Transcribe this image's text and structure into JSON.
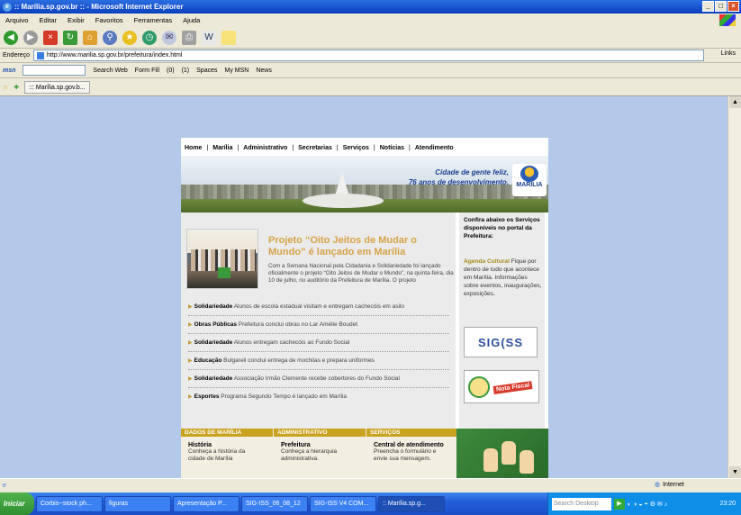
{
  "window": {
    "title": ":: Marília.sp.gov.br :: - Microsoft Internet Explorer"
  },
  "menu": [
    "Arquivo",
    "Editar",
    "Exibir",
    "Favoritos",
    "Ferramentas",
    "Ajuda"
  ],
  "address": {
    "label": "Endereço",
    "url": "http://www.marilia.sp.gov.br/prefeitura/index.html",
    "links": "Links"
  },
  "msnbar": {
    "logo": "msn",
    "search": "Search Web",
    "formfill": "Form Fill",
    "mail": "(0)",
    "contacts": "(1)",
    "spaces": "Spaces",
    "mymsn": "My MSN",
    "news": "News"
  },
  "tab": {
    "label": "::: Marília.sp.gov.b..."
  },
  "site": {
    "nav": [
      "Home",
      "Marília",
      "Administrativo",
      "Secretarias",
      "Serviços",
      "Notícias",
      "Atendimento"
    ],
    "slogan1": "Cidade de gente feliz,",
    "slogan2": "76 anos de desenvolvimento.",
    "logo": "MARÍLIA",
    "feature": {
      "title": "Projeto “Oito Jeitos de Mudar o Mundo” é lançado em Marília",
      "text": "Com a Semana Nacional pela Cidadania e Solidariedade foi lançado oficialmente o projeto “Oito Jeitos de Mudar o Mundo”, na quinta-feira, dia 10 de julho, no auditório da Prefeitura de Marília. O projeto"
    },
    "news": [
      {
        "cat": "Solidariedade",
        "text": "Alunos de escola estadual visitam e entregam cachecóis em asilo"
      },
      {
        "cat": "Obras Públicas",
        "text": "Prefeitura conclui obras no Lar Amélie Boudet"
      },
      {
        "cat": "Solidariedade",
        "text": "Alunos entregam cachecóis ao Fundo Social"
      },
      {
        "cat": "Educação",
        "text": "Bulgareli conclui entrega de mochilas e prepara uniformes"
      },
      {
        "cat": "Solidariedade",
        "text": "Associação Irmão Clemente recebe cobertores do Fundo Social"
      },
      {
        "cat": "Esportes",
        "text": "Programa Segundo Tempo é lançado em Marília"
      }
    ],
    "side": {
      "intro": "Confira abaixo os Serviços disponíveis no portal da Prefeitura:",
      "agenda_title": "Agenda Cultural",
      "agenda_text": "Fique por dentro de tudo que acontece em Marília. Informações sobre eventos, inaugurações, exposições.",
      "sigiss": "SIG(SS",
      "nota": "Nota Fiscal"
    },
    "footer": [
      {
        "hdr": "DADOS DE MARÍLIA",
        "h": "História",
        "t1": "Conheça a história da",
        "t2": "cidade de Marília"
      },
      {
        "hdr": "ADMINISTRATIVO",
        "h": "Prefeitura",
        "t1": "Conheça a hierarquia",
        "t2": "administrativa."
      },
      {
        "hdr": "SERVIÇOS",
        "h": "Central de atendimento",
        "t1": "Preencha o formulário e",
        "t2": "envie sua mensagem."
      }
    ]
  },
  "status": {
    "zone": "Internet"
  },
  "taskbar": {
    "start": "Iniciar",
    "tasks": [
      "Corbis--stock ph...",
      "figuras",
      "Apresentação P...",
      "SIG-ISS_06_08_12",
      "SIG-ISS V4 COM...",
      ":: Marília.sp.g..."
    ],
    "desktop_search": "Search Desktop",
    "clock": "23:20"
  }
}
